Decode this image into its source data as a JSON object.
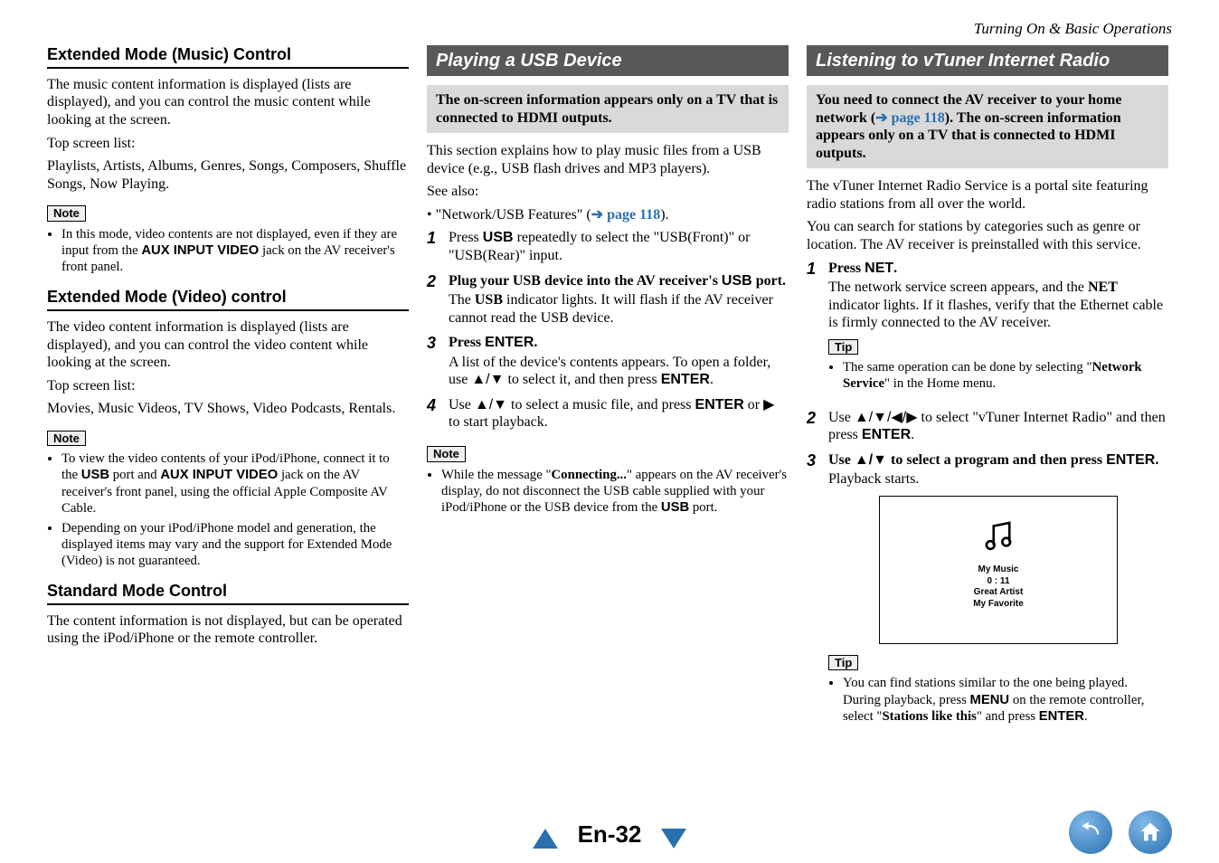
{
  "header": {
    "breadcrumb": "Turning On & Basic Operations"
  },
  "col1": {
    "h1": "Extended Mode (Music) Control",
    "p1": "The music content information is displayed (lists are displayed), and you can control the music content while looking at the screen.",
    "p2": "Top screen list:",
    "p3": "Playlists, Artists, Albums, Genres, Songs, Composers, Shuffle Songs, Now Playing.",
    "note1_label": "Note",
    "note1_item_prefix": "In this mode, video contents are not displayed, even if they are input from the ",
    "note1_item_bold": "AUX INPUT VIDEO",
    "note1_item_suffix": " jack on the AV receiver's front panel.",
    "h2": "Extended Mode (Video) control",
    "p4": "The video content information is displayed (lists are displayed), and you can control the video content while looking at the screen.",
    "p5": "Top screen list:",
    "p6": "Movies, Music Videos, TV Shows, Video Podcasts, Rentals.",
    "note2_label": "Note",
    "note2_i1_a": "To view the video contents of your iPod/iPhone, connect it to the ",
    "note2_i1_b": "USB",
    "note2_i1_c": " port and ",
    "note2_i1_d": "AUX INPUT VIDEO",
    "note2_i1_e": " jack on the AV receiver's front panel, using the official Apple Composite AV Cable.",
    "note2_i2": "Depending on your iPod/iPhone model and generation, the displayed items may vary and the support for Extended Mode (Video) is not guaranteed.",
    "h3": "Standard Mode Control",
    "p7": "The content information is not displayed, but can be operated using the iPod/iPhone or the remote controller."
  },
  "col2": {
    "banner": "Playing a USB Device",
    "highlight": "The on-screen information appears only on a TV that is connected to HDMI outputs.",
    "intro1": "This section explains how to play music files from a USB device (e.g., USB flash drives and MP3 players).",
    "intro2": "See also:",
    "intro3_a": "• \"Network/USB Features\" (",
    "intro3_link": "➔ page 118",
    "intro3_b": ").",
    "s1_num": "1",
    "s1_a": "Press ",
    "s1_b": "USB",
    "s1_c": " repeatedly to select the \"USB(Front)\" or \"USB(Rear)\" input.",
    "s2_num": "2",
    "s2_a": "Plug your USB device into the AV receiver's ",
    "s2_b": "USB",
    "s2_c": " port.",
    "s2_d_a": "The ",
    "s2_d_b": "USB",
    "s2_d_c": " indicator lights. It will flash if the AV receiver cannot read the USB device.",
    "s3_num": "3",
    "s3_a": "Press ",
    "s3_b": "ENTER",
    "s3_c": ".",
    "s3_detail_a": "A list of the device's contents appears. To open a folder, use ",
    "s3_detail_arr": "▲/▼",
    "s3_detail_b": " to select it, and then press ",
    "s3_detail_c": "ENTER",
    "s3_detail_d": ".",
    "s4_num": "4",
    "s4_a": "Use ",
    "s4_arr": "▲/▼",
    "s4_b": " to select a music file, and press ",
    "s4_c": "ENTER",
    "s4_d": " or ",
    "s4_e": "▶",
    "s4_f": " to start playback.",
    "note_label": "Note",
    "note_a": "While the message \"",
    "note_b": "Connecting...",
    "note_c": "\" appears on the AV receiver's display, do not disconnect the USB cable supplied with your iPod/iPhone or the USB device from the ",
    "note_d": "USB",
    "note_e": " port."
  },
  "col3": {
    "banner": "Listening to vTuner Internet Radio",
    "highlight_a": "You need to connect the AV receiver to your home network (",
    "highlight_link": "➔ page 118",
    "highlight_b": "). The on-screen information appears only on a TV that is connected to HDMI outputs.",
    "intro1": "The vTuner Internet Radio Service is a portal site featuring radio stations from all over the world.",
    "intro2": "You can search for stations by categories such as genre or location. The AV receiver is preinstalled with this service.",
    "s1_num": "1",
    "s1_a": "Press ",
    "s1_b": "NET",
    "s1_c": ".",
    "s1_d_a": "The network service screen appears, and the ",
    "s1_d_b": "NET",
    "s1_d_c": " indicator lights. If it flashes, verify that the Ethernet cable is firmly connected to the AV receiver.",
    "tip1_label": "Tip",
    "tip1_a": "The same operation can be done by selecting \"",
    "tip1_b": "Network Service",
    "tip1_c": "\" in the Home menu.",
    "s2_num": "2",
    "s2_a": "Use ",
    "s2_arr": "▲/▼/◀/▶",
    "s2_b": " to select \"vTuner Internet Radio\" and then press ",
    "s2_c": "ENTER",
    "s2_d": ".",
    "s3_num": "3",
    "s3_a": "Use ",
    "s3_arr": "▲/▼",
    "s3_b": " to select a program and then press ",
    "s3_c": "ENTER",
    "s3_d": ".",
    "s3_detail": "Playback starts.",
    "screenshot": {
      "l1": "My Music",
      "l2": "0 : 11",
      "l3": "Great Artist",
      "l4": "My Favorite"
    },
    "tip2_label": "Tip",
    "tip2_a": "You can find stations similar to the one being played. During playback, press ",
    "tip2_b": "MENU",
    "tip2_c": " on the remote controller, select \"",
    "tip2_d": "Stations like this",
    "tip2_e": "\" and press ",
    "tip2_f": "ENTER",
    "tip2_g": "."
  },
  "footer": {
    "page": "En-32"
  }
}
